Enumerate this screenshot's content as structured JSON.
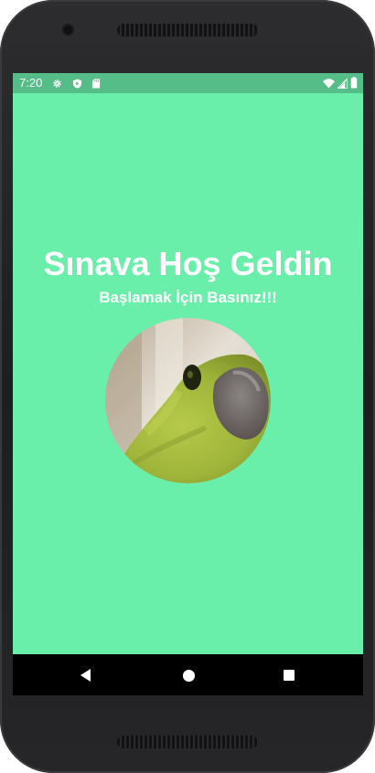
{
  "status_bar": {
    "time": "7:20",
    "left_icons": [
      "gear-icon",
      "shield-play-icon",
      "sd-card-icon"
    ],
    "right_icons": [
      "wifi-icon",
      "cell-signal-icon",
      "battery-icon"
    ],
    "background_color": "#55bd87"
  },
  "main": {
    "title": "Sınava Hoş Geldin",
    "subtitle": "Başlamak İçin Basınız!!!",
    "image": "parrot-photo",
    "background_color": "#6aefaa"
  },
  "nav_bar": {
    "buttons": [
      "back-icon",
      "home-icon",
      "recents-icon"
    ]
  }
}
